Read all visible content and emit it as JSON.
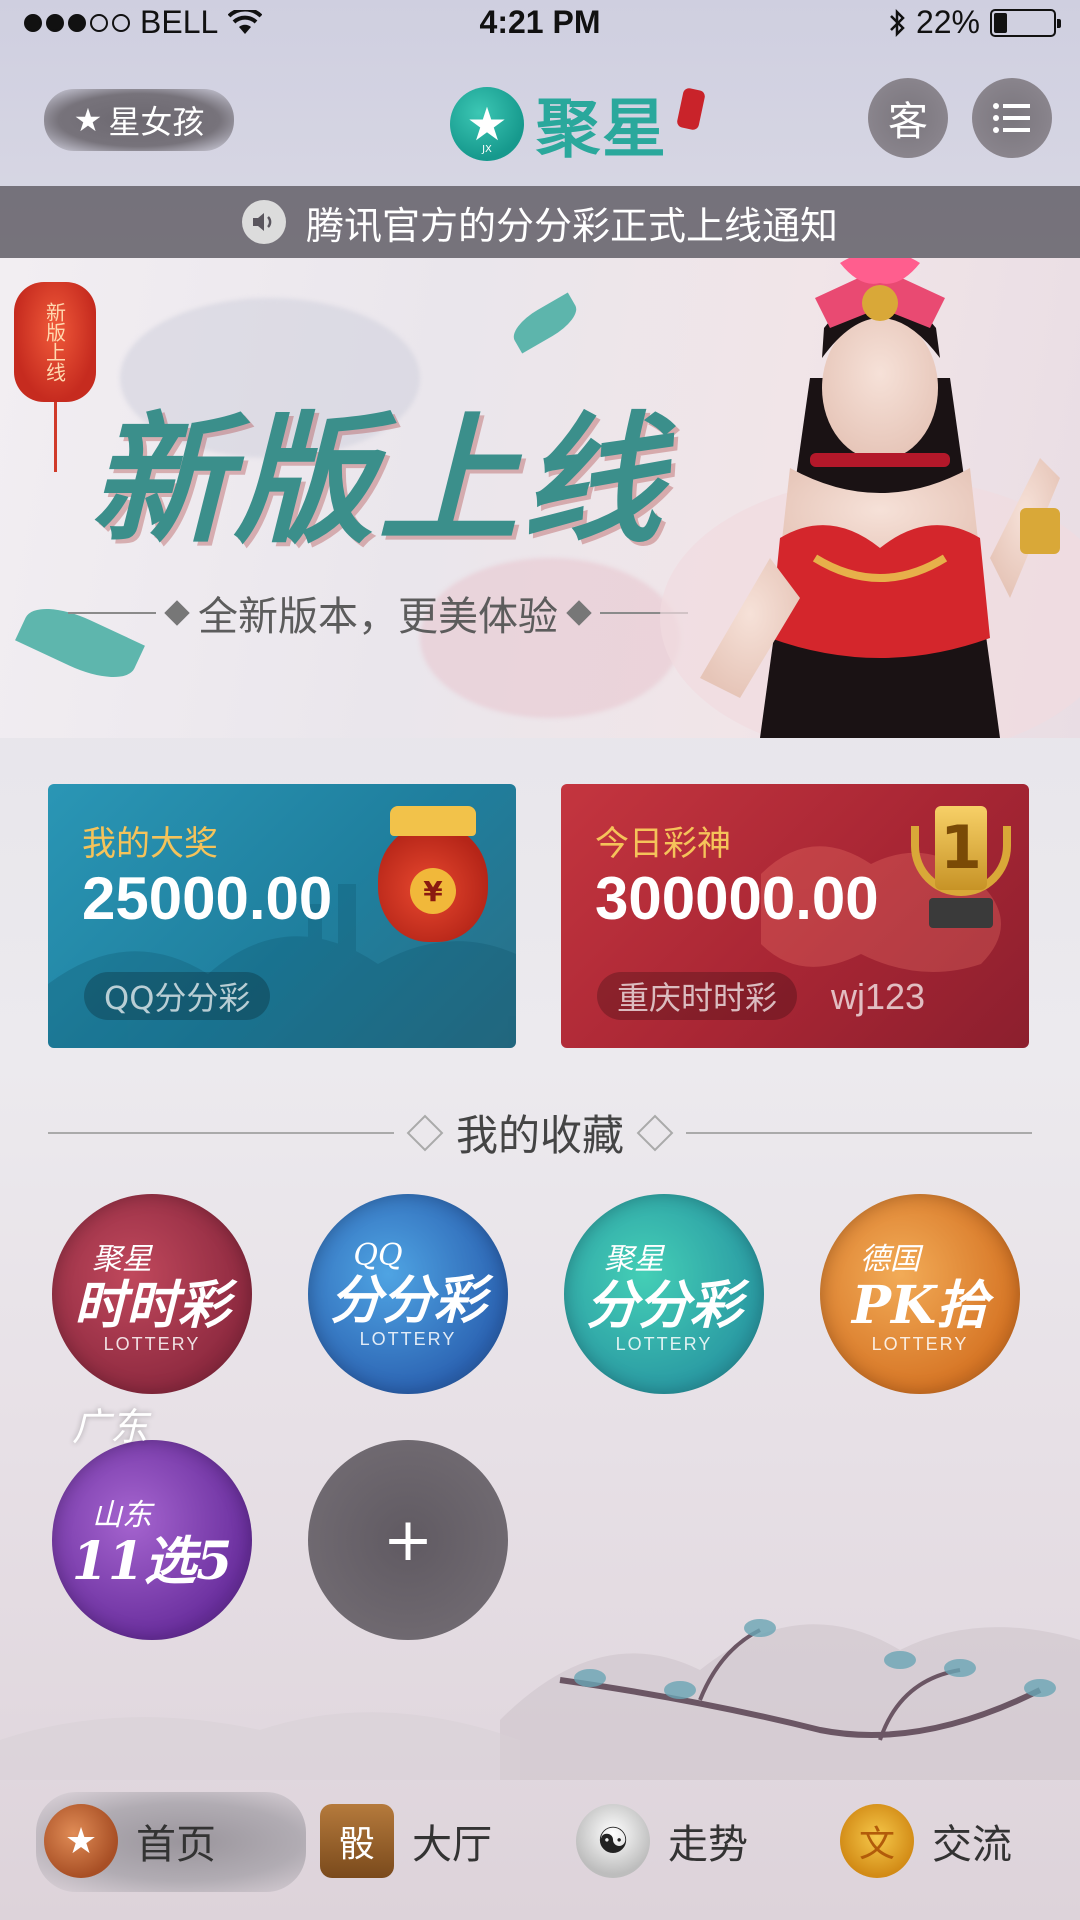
{
  "status_bar": {
    "carrier": "BELL",
    "time": "4:21 PM",
    "battery": "22%",
    "battery_level": 0.22,
    "signal_dots_filled": 3,
    "signal_dots_total": 5
  },
  "header": {
    "user_name": "星女孩",
    "user_star": "★",
    "logo_text": "聚星",
    "logo_badge": "JX",
    "service_label": "客",
    "menu_icon": "menu-icon"
  },
  "notice": {
    "text": "腾讯官方的分分彩正式上线通知"
  },
  "banner": {
    "lantern_text": "新版上线",
    "title": "新版上线",
    "subtitle": "全新版本，更美体验"
  },
  "cards": {
    "jackpot": {
      "label": "我的大奖",
      "amount": "25000.00",
      "game": "QQ分分彩",
      "coin": "¥"
    },
    "god": {
      "label": "今日彩神",
      "amount": "300000.00",
      "game": "重庆时时彩",
      "user": "wj123",
      "rank": "1"
    }
  },
  "favorites": {
    "title": "我的收藏",
    "lottery_word": "LOTTERY",
    "items": [
      {
        "small": "聚星",
        "big": "时时彩"
      },
      {
        "small": "QQ",
        "big": "分分彩"
      },
      {
        "small": "聚星",
        "big": "分分彩"
      },
      {
        "small": "德国",
        "big": "PK拾"
      },
      {
        "top": "广东",
        "small": "山东",
        "big": "11选5"
      }
    ],
    "add_label": "+"
  },
  "tabbar": {
    "items": [
      {
        "label": "首页",
        "icon": "home-star-icon",
        "glyph": "★"
      },
      {
        "label": "大厅",
        "icon": "hall-icon",
        "glyph": "骰"
      },
      {
        "label": "走势",
        "icon": "yin-yang-icon",
        "glyph": "☯"
      },
      {
        "label": "交流",
        "icon": "chat-coin-icon",
        "glyph": "文"
      }
    ]
  },
  "colors": {
    "accent_teal": "#2aa89c",
    "card_blue": "#1f7f9e",
    "card_red": "#a82634",
    "gold_label": "#f5c35a"
  }
}
